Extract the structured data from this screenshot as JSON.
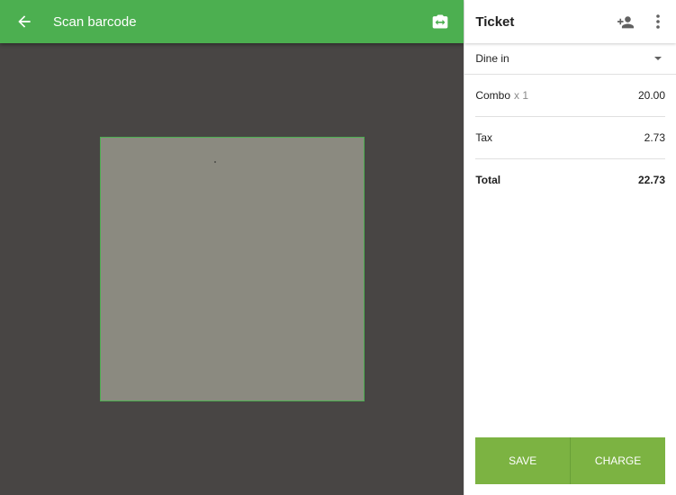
{
  "scanner": {
    "title": "Scan barcode",
    "back_icon": "arrow-back-icon",
    "camera_icon": "camera-switch-icon"
  },
  "ticket": {
    "title": "Ticket",
    "add_customer_icon": "add-customer-icon",
    "more_icon": "more-vert-icon",
    "dining_option": "Dine in",
    "items": [
      {
        "name": "Combo",
        "qty": "x 1",
        "amount": "20.00"
      }
    ],
    "tax": {
      "label": "Tax",
      "amount": "2.73"
    },
    "total": {
      "label": "Total",
      "amount": "22.73"
    },
    "save_label": "SAVE",
    "charge_label": "CHARGE"
  },
  "colors": {
    "primary_green": "#4caf50",
    "action_green": "#7cb342",
    "camera_background": "#484544"
  }
}
